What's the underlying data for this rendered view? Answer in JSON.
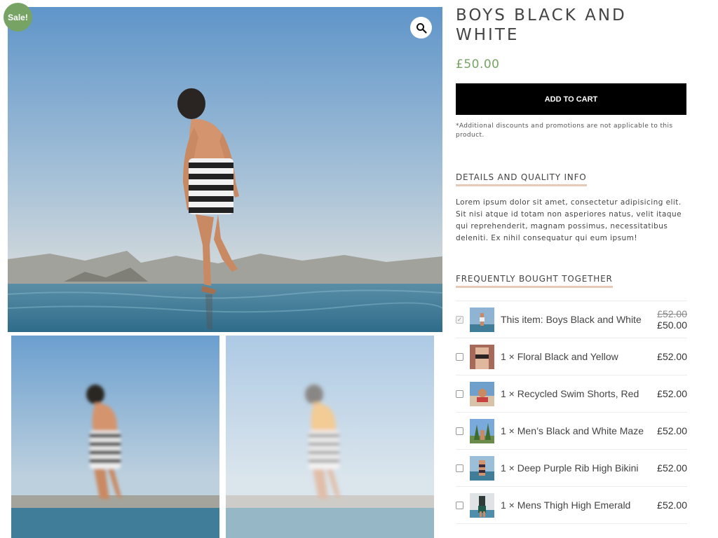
{
  "gallery": {
    "sale_label": "Sale!",
    "zoom_icon": "magnifier-icon"
  },
  "product": {
    "title": "BOYS BLACK AND WHITE",
    "price": "£50.00",
    "add_to_cart_label": "ADD TO CART",
    "disclaimer": "*Additional discounts and promotions are not applicable to this product."
  },
  "details": {
    "heading": "DETAILS AND QUALITY INFO",
    "text": "Lorem ipsum dolor sit amet, consectetur adipisicing elit. Sit nisi atque id totam non asperiores natus, velit itaque qui reprehenderit, magnam possimus, necessitatibus deleniti. Ex nihil consequatur qui eum ipsum!"
  },
  "fbt": {
    "heading": "FREQUENTLY BOUGHT TOGETHER",
    "items": [
      {
        "name": "This item: Boys Black and White",
        "old_price": "£52.00",
        "price": "£50.00",
        "checked": true
      },
      {
        "name": "1 × Floral Black and Yellow",
        "price": "£52.00",
        "checked": false
      },
      {
        "name": "1 × Recycled Swim Shorts, Red",
        "price": "£52.00",
        "checked": false
      },
      {
        "name": "1 × Men’s Black and White Maze",
        "price": "£52.00",
        "checked": false
      },
      {
        "name": "1 × Deep Purple Rib High Bikini",
        "price": "£52.00",
        "checked": false
      },
      {
        "name": "1 × Mens Thigh High Emerald",
        "price": "£52.00",
        "checked": false
      }
    ]
  },
  "colors": {
    "sale_badge": "#77a464",
    "price": "#77a464",
    "button_bg": "#000000",
    "heading_underline": "#e7c9b8"
  }
}
